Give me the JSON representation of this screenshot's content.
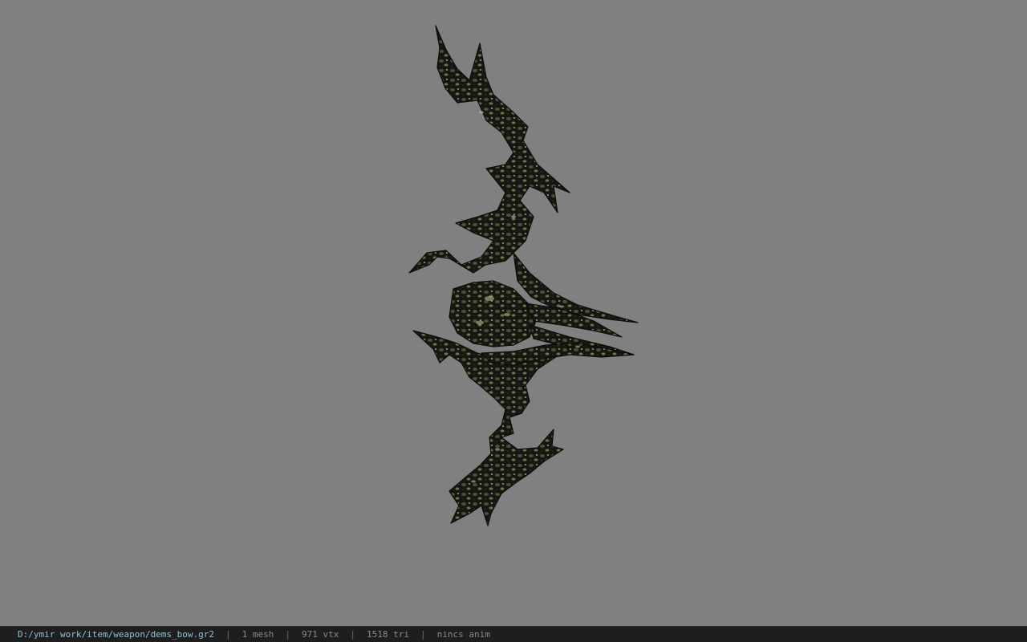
{
  "viewport": {
    "background_color": "#808080",
    "model_icon": "bow-model-icon"
  },
  "status_bar": {
    "file_path": "D:/ymir work/item/weapon/dems_bow.gr2",
    "separator": "|",
    "mesh_count": "1 mesh",
    "vertex_count": "971 vtx",
    "triangle_count": "1518 tri",
    "animation": "nincs anim",
    "text_color": "#8a8a8a",
    "path_color": "#8fc0d8",
    "background_color": "#1e1e1e"
  }
}
